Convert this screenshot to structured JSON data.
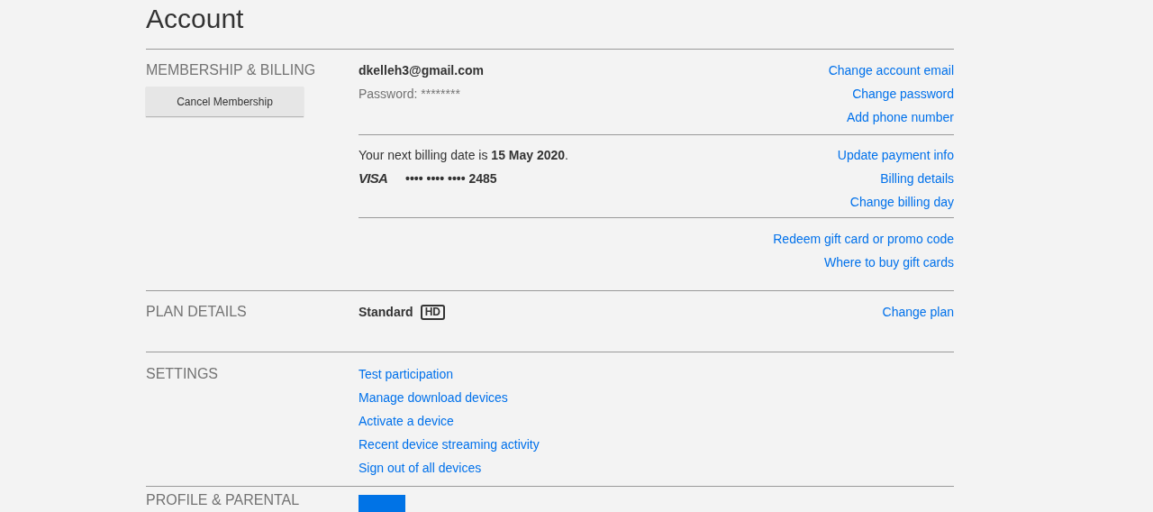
{
  "title": "Account",
  "sections": [
    {
      "kind": "membership",
      "label": "MEMBERSHIP & BILLING",
      "button": "Cancel Membership",
      "blocks": [
        {
          "items": [
            {
              "kind": "email",
              "text": "**dkelleh3@gmail.com**"
            },
            {
              "kind": "muted",
              "text": "Password: ********"
            }
          ],
          "links": [
            "Change account email",
            "Change password",
            "Add phone number"
          ]
        },
        {
          "items": [
            {
              "kind": "rich",
              "text": "Your next billing date is **15 May 2020**."
            },
            {
              "kind": "card",
              "brand": "VISA",
              "text": "**•••• •••• •••• 2485**"
            }
          ],
          "links": [
            "Update payment info",
            "Billing details",
            "Change billing day"
          ]
        },
        {
          "links": [
            "Redeem gift card or promo code",
            "Where to buy gift cards"
          ]
        }
      ]
    },
    {
      "kind": "plan",
      "label": "PLAN DETAILS",
      "plan": "Standard",
      "badge": "HD",
      "links": [
        "Change plan"
      ]
    },
    {
      "kind": "settings",
      "label": "SETTINGS",
      "links": [
        "Test participation",
        "Manage download devices",
        "Activate a device",
        "Recent device streaming activity",
        "Sign out of all devices"
      ]
    },
    {
      "kind": "profile",
      "label": "PROFILE & PARENTAL"
    }
  ]
}
